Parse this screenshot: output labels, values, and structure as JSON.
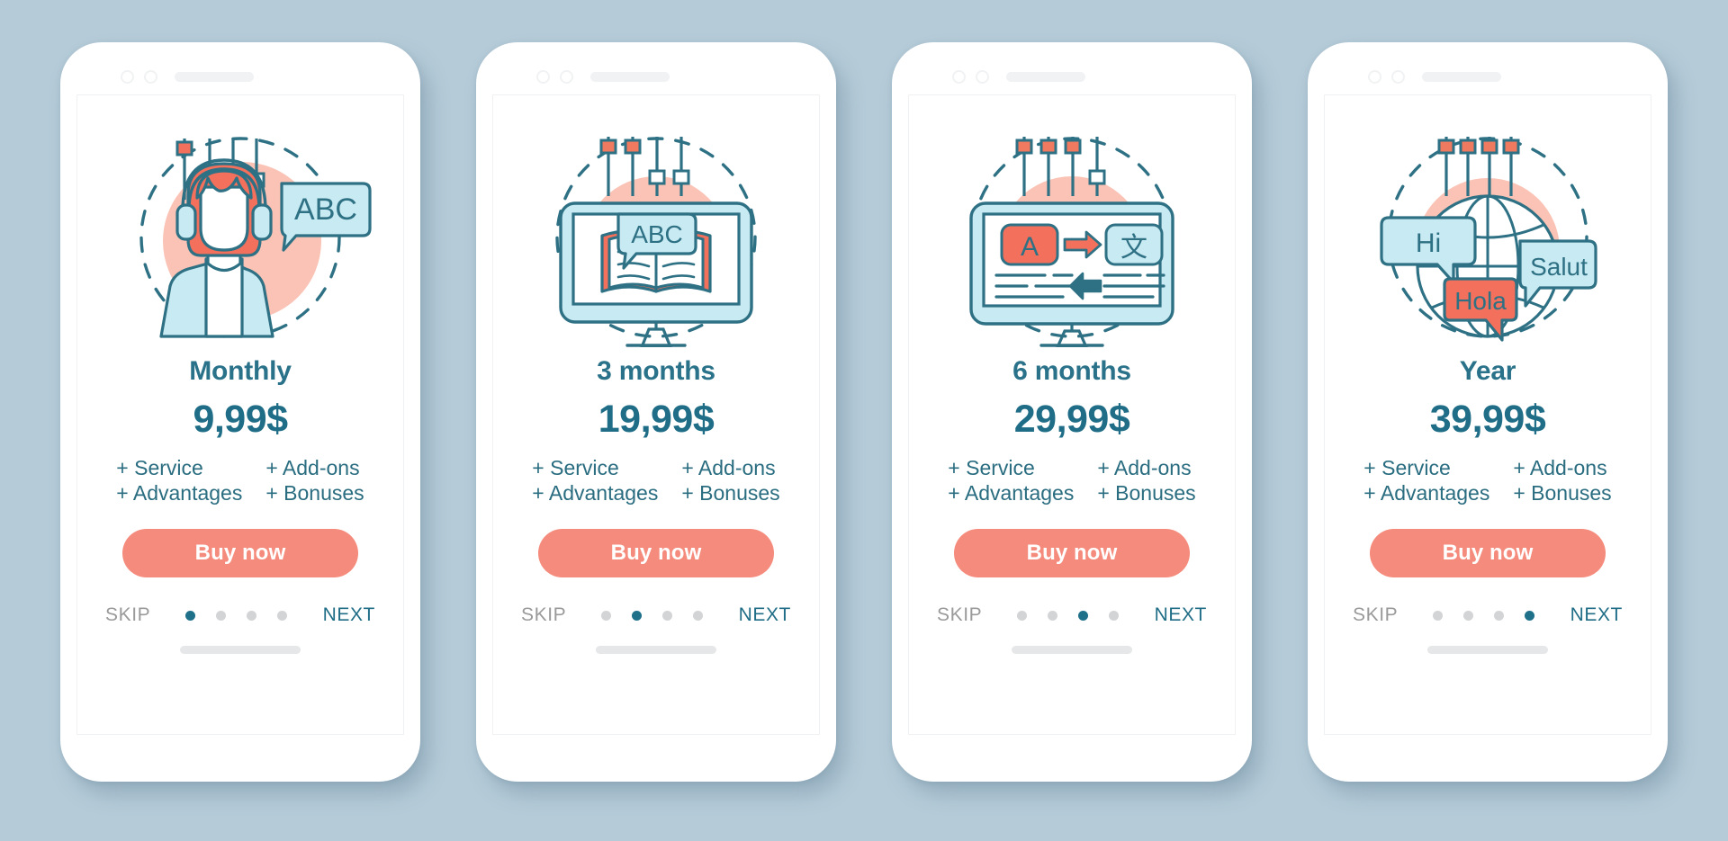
{
  "meta": {
    "background_color": "#b5cbd8",
    "accent_coral": "#f58b7c",
    "accent_teal": "#2a7289",
    "light_blue": "#c8eaf2",
    "dot_inactive": "#d3d4d5"
  },
  "cards": [
    {
      "illustration": "woman-with-headset-abc-icon",
      "title": "Monthly",
      "price": "9,99$",
      "features": [
        "+ Service",
        "+ Add-ons",
        "+ Advantages",
        "+ Bonuses"
      ],
      "buy_label": "Buy now",
      "skip_label": "SKIP",
      "next_label": "NEXT",
      "active_dot": 0,
      "dot_count": 4
    },
    {
      "illustration": "monitor-with-open-book-abc-icon",
      "title": "3 months",
      "price": "19,99$",
      "features": [
        "+ Service",
        "+ Add-ons",
        "+ Advantages",
        "+ Bonuses"
      ],
      "buy_label": "Buy now",
      "skip_label": "SKIP",
      "next_label": "NEXT",
      "active_dot": 1,
      "dot_count": 4
    },
    {
      "illustration": "monitor-translation-a-to-chinese-icon",
      "title": "6 months",
      "price": "29,99$",
      "features": [
        "+ Service",
        "+ Add-ons",
        "+ Advantages",
        "+ Bonuses"
      ],
      "buy_label": "Buy now",
      "skip_label": "SKIP",
      "next_label": "NEXT",
      "active_dot": 2,
      "dot_count": 4
    },
    {
      "illustration": "globe-with-greeting-speech-bubbles-icon",
      "title": "Year",
      "price": "39,99$",
      "features": [
        "+ Service",
        "+ Add-ons",
        "+ Advantages",
        "+ Bonuses"
      ],
      "buy_label": "Buy now",
      "skip_label": "SKIP",
      "next_label": "NEXT",
      "active_dot": 3,
      "dot_count": 4
    }
  ],
  "illustration_text": {
    "card1_bubble": "ABC",
    "card2_bubble": "ABC",
    "card3_source": "A",
    "card3_target": "文",
    "card4_bubble_1": "Hi",
    "card4_bubble_2": "Salut",
    "card4_bubble_3": "Hola"
  }
}
